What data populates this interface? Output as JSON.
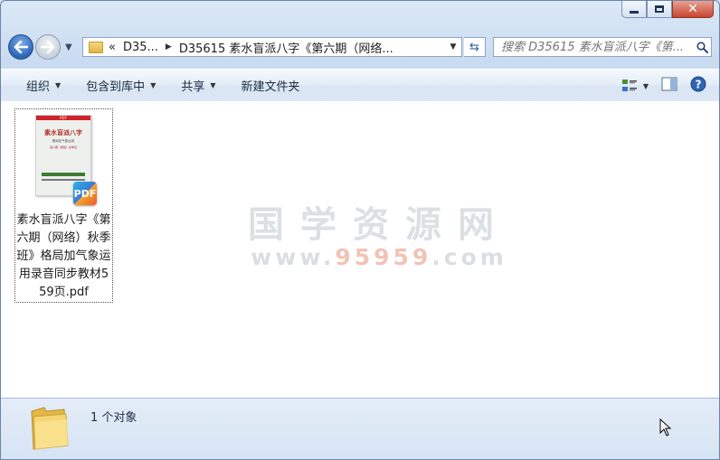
{
  "window": {
    "controls": {
      "minimize": "minimize",
      "maximize": "maximize",
      "close": "✕"
    }
  },
  "nav": {
    "breadcrumb_overflow": "«",
    "breadcrumbs": [
      "D35...",
      "D35615 素水盲派八字《第六期（网络..."
    ],
    "search_placeholder": "搜索 D35615 素水盲派八字《第..."
  },
  "toolbar": {
    "organize": "组织",
    "include_library": "包含到库中",
    "share": "共享",
    "new_folder": "新建文件夹"
  },
  "content": {
    "files": [
      {
        "name": "素水盲派八字《第六期（网络）秋季班》格局加气象运用录音同步教材559页.pdf",
        "badge": "PDF",
        "thumb_top": "PDF",
        "thumb_title": "素水盲派八字",
        "thumb_sub": "格局加气象运用",
        "thumb_note": "第六期（网络）秋季班"
      }
    ],
    "watermark_title": "国学资源网",
    "watermark_url_prefix": "www.",
    "watermark_url_number": "95959",
    "watermark_url_suffix": ".com"
  },
  "details": {
    "item_count": "1 个对象"
  }
}
